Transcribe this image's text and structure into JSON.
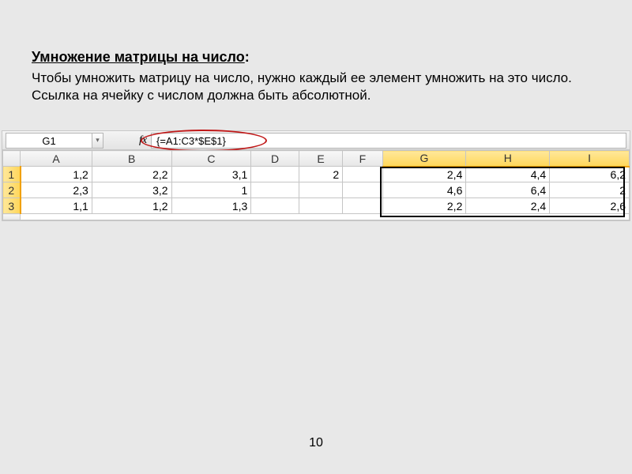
{
  "heading": "Умножение матрицы на число",
  "heading_colon": ":",
  "description": "Чтобы умножить матрицу на число, нужно каждый ее элемент умножить на это число. Ссылка на ячейку с числом должна быть абсолютной.",
  "formula_bar": {
    "namebox": "G1",
    "fx_label": "fx",
    "formula": "{=A1:C3*$E$1}"
  },
  "columns": [
    "A",
    "B",
    "C",
    "D",
    "E",
    "F",
    "G",
    "H",
    "I"
  ],
  "rows": [
    "1",
    "2",
    "3"
  ],
  "row4_label": "",
  "data": {
    "r1": {
      "A": "1,2",
      "B": "2,2",
      "C": "3,1",
      "D": "",
      "E": "2",
      "F": "",
      "G": "2,4",
      "H": "4,4",
      "I": "6,2"
    },
    "r2": {
      "A": "2,3",
      "B": "3,2",
      "C": "1",
      "D": "",
      "E": "",
      "F": "",
      "G": "4,6",
      "H": "6,4",
      "I": "2"
    },
    "r3": {
      "A": "1,1",
      "B": "1,2",
      "C": "1,3",
      "D": "",
      "E": "",
      "F": "",
      "G": "2,2",
      "H": "2,4",
      "I": "2,6"
    }
  },
  "page_number": "10",
  "chart_data": {
    "type": "table",
    "scalar": 2,
    "input_matrix": [
      [
        1.2,
        2.2,
        3.1
      ],
      [
        2.3,
        3.2,
        1.0
      ],
      [
        1.1,
        1.2,
        1.3
      ]
    ],
    "result_matrix": [
      [
        2.4,
        4.4,
        6.2
      ],
      [
        4.6,
        6.4,
        2.0
      ],
      [
        2.2,
        2.4,
        2.6
      ]
    ],
    "formula": "{=A1:C3*$E$1}"
  }
}
